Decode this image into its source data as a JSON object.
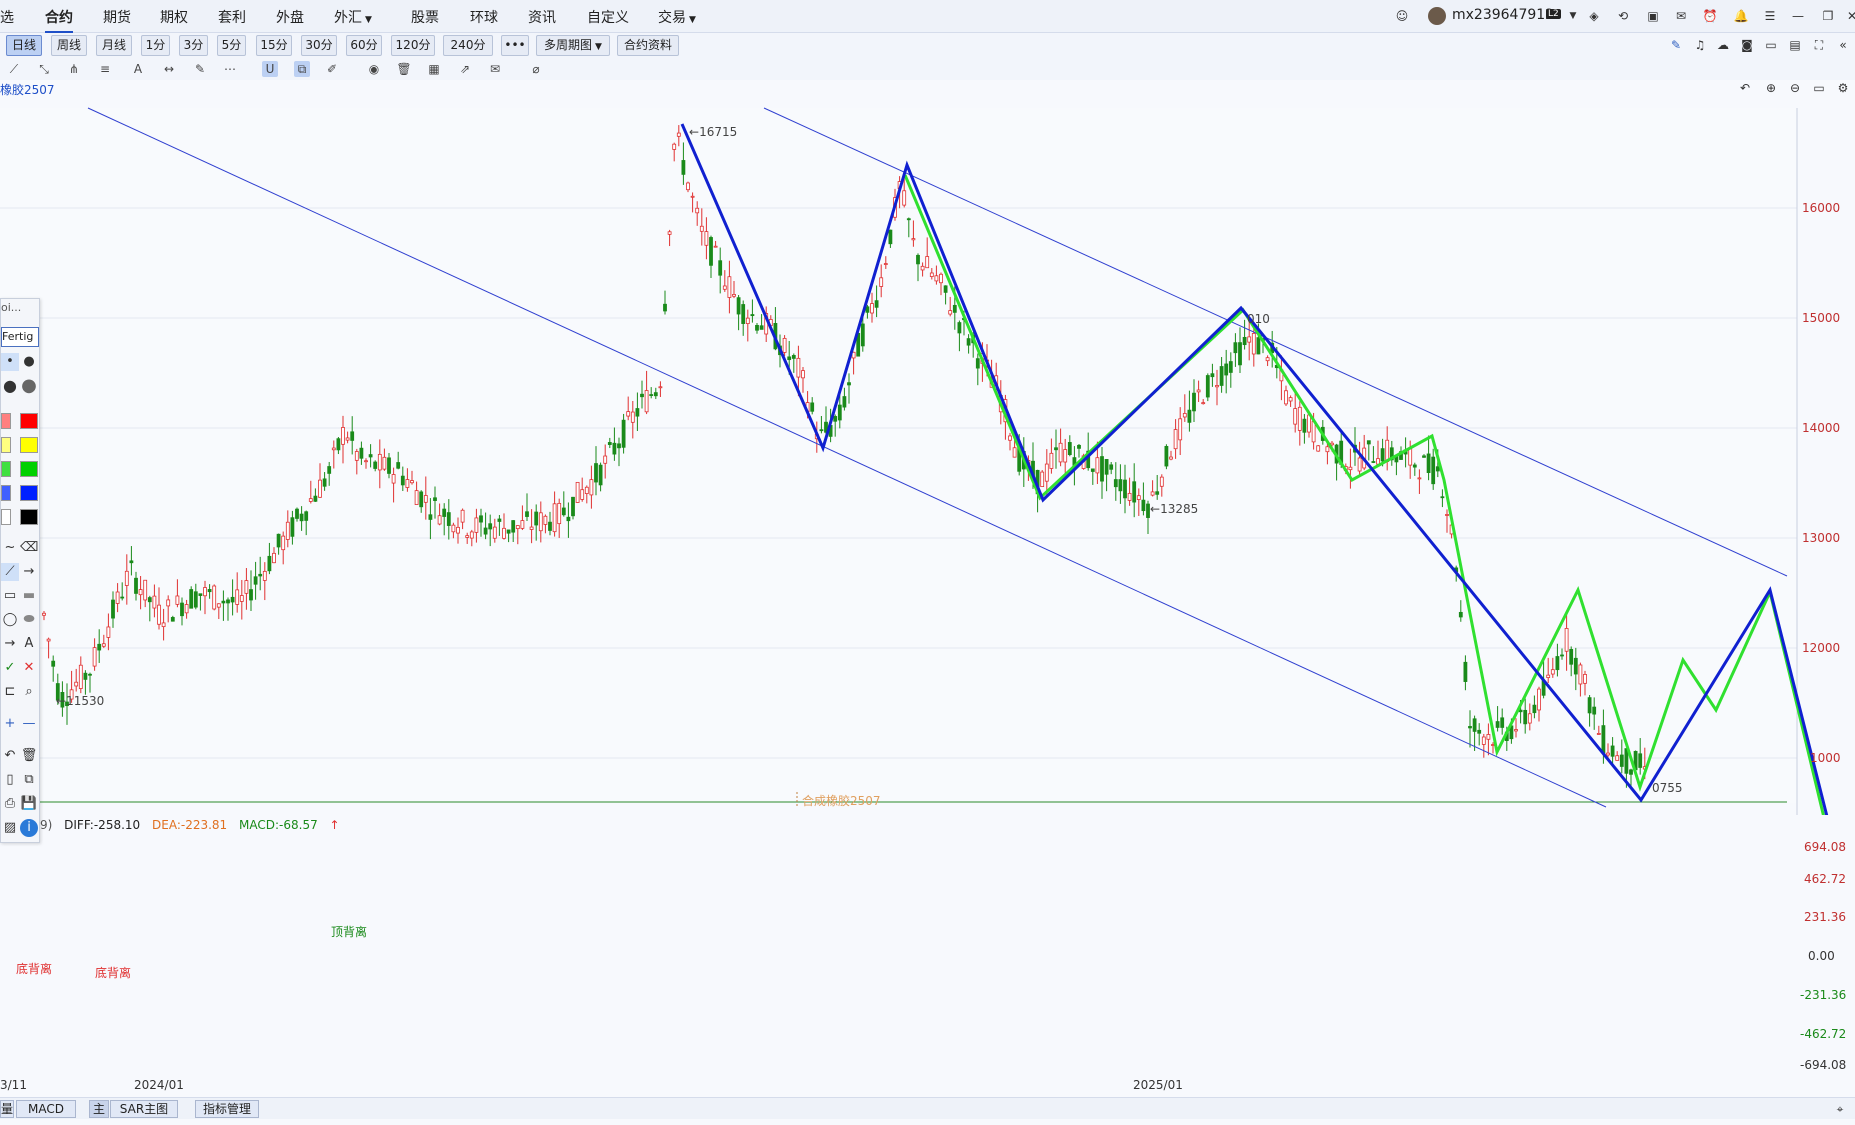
{
  "menubar": {
    "items": [
      "选",
      "合约",
      "期货",
      "期权",
      "套利",
      "外盘",
      "外汇",
      "股票",
      "环球",
      "资讯",
      "自定义",
      "交易"
    ],
    "user": "mx239647912",
    "badge": "L2"
  },
  "periods": [
    "日线",
    "周线",
    "月线",
    "1分",
    "3分",
    "5分",
    "15分",
    "30分",
    "60分",
    "120分",
    "240分",
    "•••",
    "多周期图",
    "合约资料"
  ],
  "instrument": "橡胶2507",
  "chart": {
    "price_labels": [
      "16000",
      "15000",
      "14000",
      "13000",
      "12000",
      "1000"
    ],
    "annotations": {
      "high": "16715",
      "low_left": "11530",
      "peak2": "010",
      "mid_low": "13285",
      "low_right": "0755",
      "watermark": "合成橡胶2507"
    }
  },
  "macd": {
    "prefix": "9)",
    "diff": "DIFF:-258.10",
    "dea": "DEA:-223.81",
    "macd": "MACD:-68.57",
    "axis_labels": [
      "694.08",
      "462.72",
      "231.36",
      "0.00",
      "-231.36",
      "-462.72",
      "-694.08"
    ],
    "div_labels": [
      "底背离",
      "底背离",
      "顶背离"
    ]
  },
  "dates": [
    "3/11",
    "2024/01",
    "2025/01"
  ],
  "bottom_tabs": [
    "量",
    "MACD",
    "主",
    "SAR主图",
    "指标管理"
  ],
  "draw_panel": {
    "title": "oi...",
    "button": "Fertig"
  },
  "colors": {
    "up": "#e03030",
    "down": "#1a8a1a",
    "blue_line": "#1020d0",
    "green_line": "#30e030",
    "channel": "#3040d0"
  }
}
